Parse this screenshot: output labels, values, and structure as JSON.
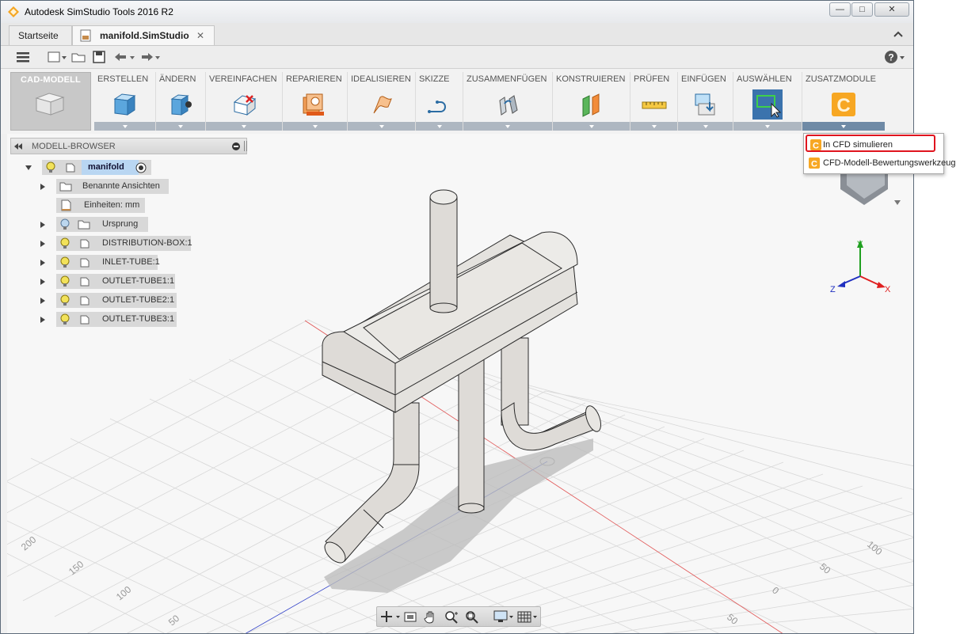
{
  "window": {
    "title": "Autodesk SimStudio Tools 2016 R2",
    "buttons": {
      "minimize": "—",
      "maximize": "□",
      "close": "✕"
    }
  },
  "tabs": [
    {
      "label": "Startseite",
      "active": false
    },
    {
      "label": "manifold.SimStudio",
      "active": true,
      "close": "✕"
    }
  ],
  "toolbar": {
    "help": "?"
  },
  "ribbon": {
    "workspace": "CAD-MODELL",
    "panels": [
      {
        "label": "ERSTELLEN",
        "icon": "box-icon"
      },
      {
        "label": "ÄNDERN",
        "icon": "press-pull-icon"
      },
      {
        "label": "VEREINFACHEN",
        "icon": "remove-features-icon"
      },
      {
        "label": "REPARIEREN",
        "icon": "repair-icon"
      },
      {
        "label": "IDEALISIEREN",
        "icon": "idealize-icon"
      },
      {
        "label": "SKIZZE",
        "icon": "sketch-icon"
      },
      {
        "label": "ZUSAMMENFÜGEN",
        "icon": "joint-icon"
      },
      {
        "label": "KONSTRUIEREN",
        "icon": "plane-icon"
      },
      {
        "label": "PRÜFEN",
        "icon": "measure-icon"
      },
      {
        "label": "EINFÜGEN",
        "icon": "insert-icon"
      },
      {
        "label": "AUSWÄHLEN",
        "icon": "select-icon"
      },
      {
        "label": "ZUSATZMODULE",
        "icon": "addin-cfd-icon"
      }
    ]
  },
  "browser": {
    "title": "MODELL-BROWSER",
    "root": "manifold",
    "items": [
      {
        "label": "Benannte Ansichten"
      },
      {
        "label": "Einheiten: mm"
      },
      {
        "label": "Ursprung"
      },
      {
        "label": "DISTRIBUTION-BOX:1"
      },
      {
        "label": "INLET-TUBE:1"
      },
      {
        "label": "OUTLET-TUBE1:1"
      },
      {
        "label": "OUTLET-TUBE2:1"
      },
      {
        "label": "OUTLET-TUBE3:1"
      }
    ]
  },
  "dropdown": {
    "items": [
      {
        "label": "In CFD simulieren",
        "highlighted": true
      },
      {
        "label": "CFD-Modell-Bewertungswerkzeug",
        "highlighted": false
      }
    ]
  },
  "viewport": {
    "axes": {
      "x": "X",
      "y": "Y",
      "z": "Z"
    },
    "grid_labels_left": [
      "200",
      "150",
      "100",
      "50"
    ],
    "grid_labels_right": [
      "100",
      "50",
      "0",
      "50"
    ]
  },
  "colors": {
    "accent_red": "#e0141e",
    "axis_x": "#e02020",
    "axis_y": "#20a020",
    "axis_z": "#2030c0",
    "model_fill": "#e2e0dc"
  }
}
